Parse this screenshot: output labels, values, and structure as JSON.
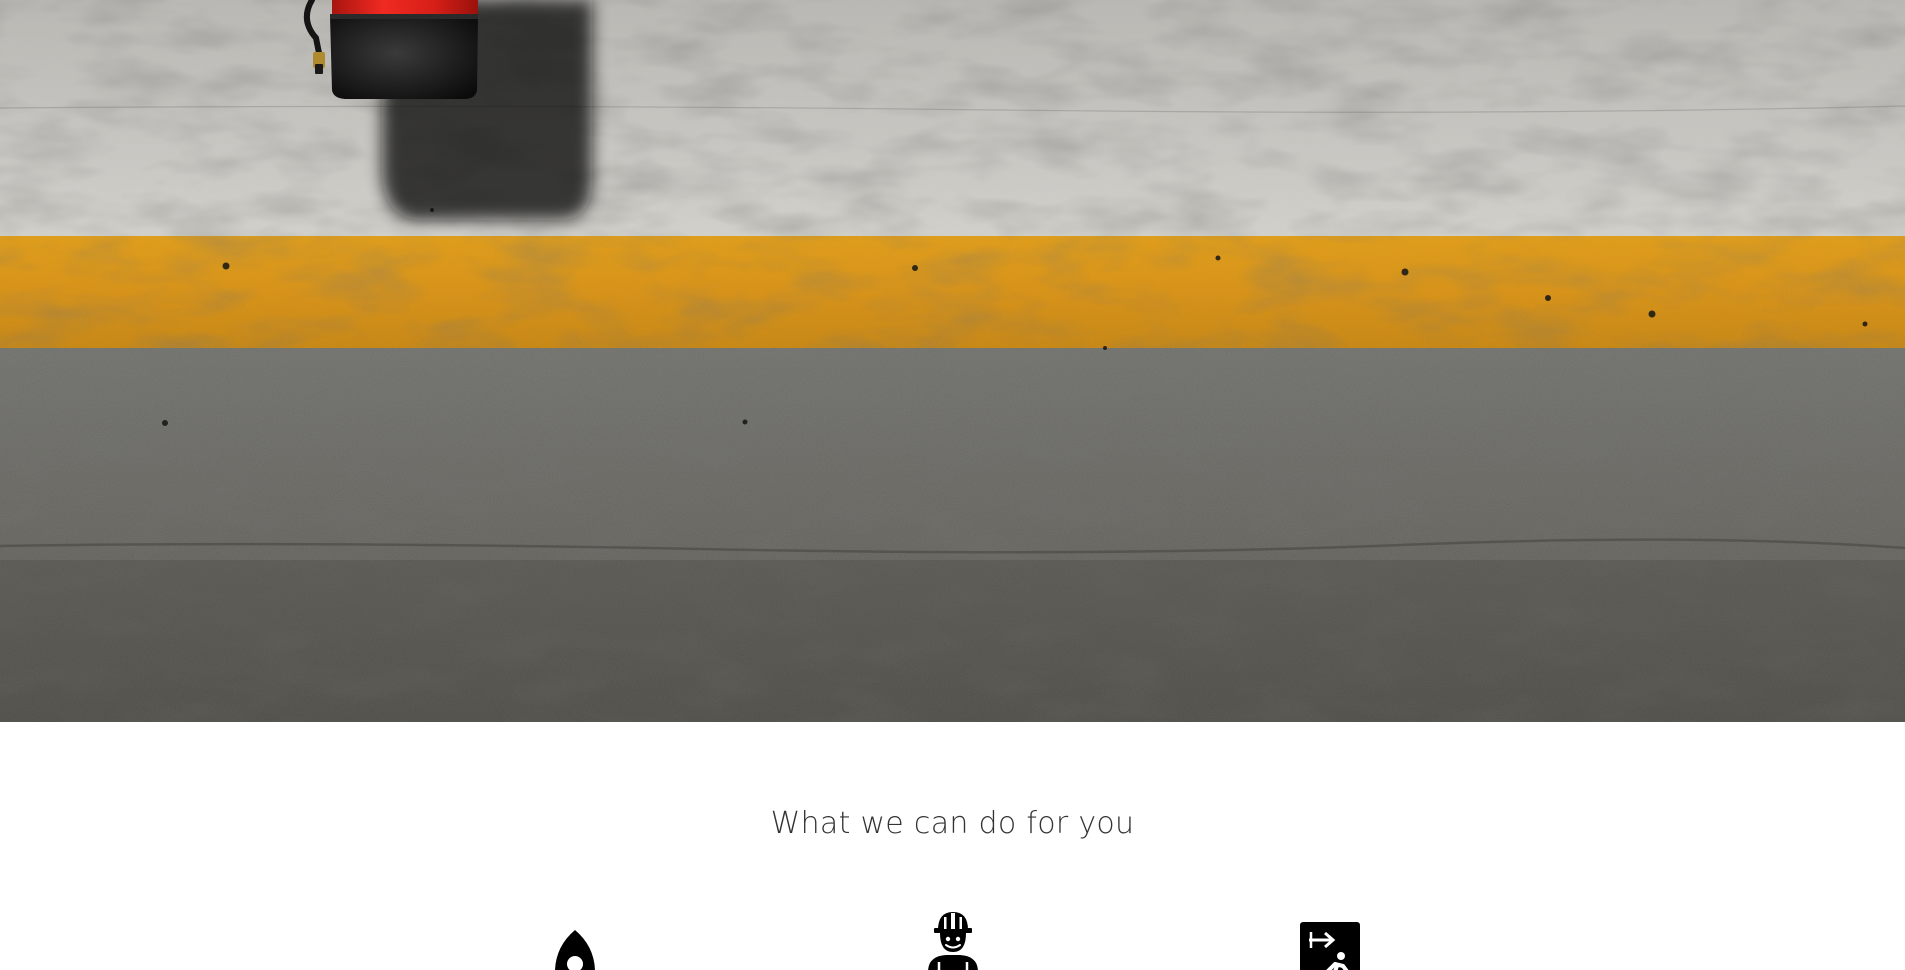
{
  "hero": {
    "background": "concrete wall with orange safety stripe",
    "stripe_color": "#e0920a",
    "object": "fire-extinguisher",
    "object_color": "#d8231c"
  },
  "services": {
    "title": "What we can do for you",
    "items": [
      {
        "icon": "rocket-icon"
      },
      {
        "icon": "worker-helmet-icon"
      },
      {
        "icon": "emergency-exit-icon"
      }
    ]
  }
}
